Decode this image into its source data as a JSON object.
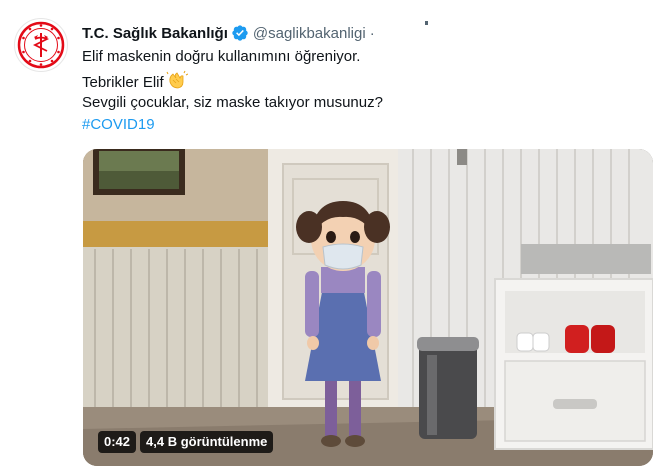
{
  "tweet": {
    "author_name": "T.C. Sağlık Bakanlığı",
    "handle": "@saglikbakanligi",
    "separator": "·",
    "lines": [
      "Elif maskenin doğru kullanımını öğreniyor.",
      "Tebrikler Elif",
      "Sevgili çocuklar, siz maske takıyor musunuz?"
    ],
    "hashtag": "#COVID19"
  },
  "video": {
    "duration": "0:42",
    "views": "4,4 B görüntülenme"
  },
  "icons": {
    "avatar": "ministry-of-health-logo",
    "verified": "verified-badge-icon",
    "clap": "clapping-hands-emoji"
  },
  "colors": {
    "accent": "#1d9bf0",
    "logo_red": "#e30a17",
    "handle_gray": "#536471"
  }
}
